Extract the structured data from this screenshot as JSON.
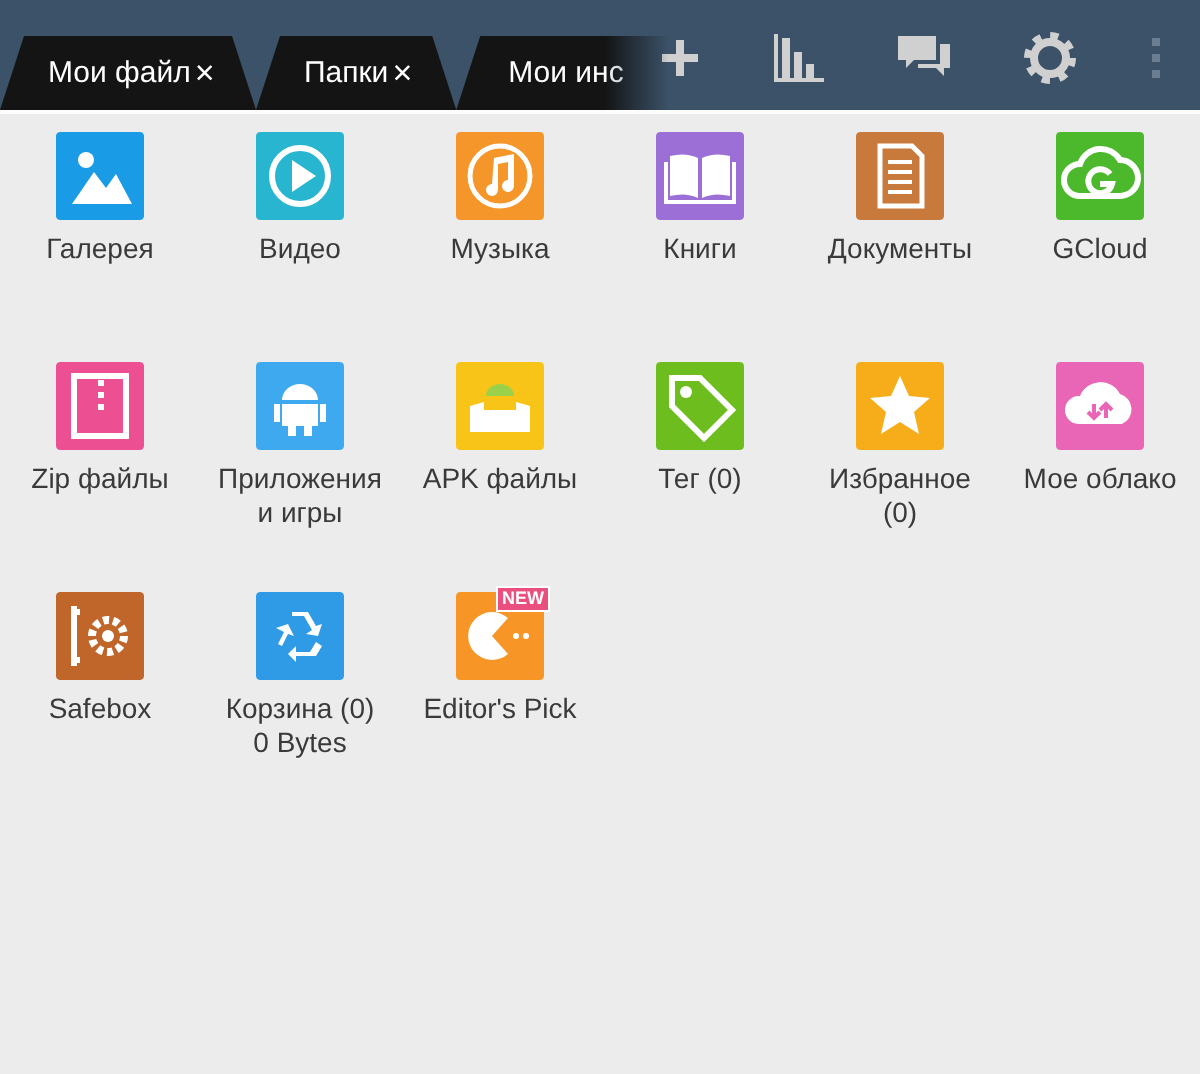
{
  "tabs": [
    {
      "label": "Мои файл",
      "close": "×"
    },
    {
      "label": "Папки",
      "close": "×"
    },
    {
      "label": "Мои инс"
    }
  ],
  "items": [
    {
      "label": "Галерея",
      "kind": "gallery",
      "color": "#1a9be6"
    },
    {
      "label": "Видео",
      "kind": "video",
      "color": "#27b5cf"
    },
    {
      "label": "Музыка",
      "kind": "music",
      "color": "#f5962a"
    },
    {
      "label": "Книги",
      "kind": "books",
      "color": "#9b6fd6"
    },
    {
      "label": "Документы",
      "kind": "documents",
      "color": "#c77a3c"
    },
    {
      "label": "GCloud",
      "kind": "gcloud",
      "color": "#4cb82c"
    },
    {
      "label": "Zip файлы",
      "kind": "zip",
      "color": "#ec4f92"
    },
    {
      "label": "Приложения и игры",
      "kind": "android",
      "color": "#3fa9f0"
    },
    {
      "label": "APK файлы",
      "kind": "apk",
      "color": "#f7c417"
    },
    {
      "label": "Тег (0)",
      "kind": "tag",
      "color": "#6dbd1e"
    },
    {
      "label": "Избранное (0)",
      "kind": "star",
      "color": "#f7ad1a"
    },
    {
      "label": "Мое облако",
      "kind": "cloud",
      "color": "#e866b5"
    },
    {
      "label": "Safebox",
      "kind": "safe",
      "color": "#c0662a"
    },
    {
      "label": "Корзина (0)",
      "detail": "0 Bytes",
      "kind": "recycle",
      "color": "#2f9be6"
    },
    {
      "label": "Editor's Pick",
      "kind": "game",
      "color": "#f79526",
      "badge": "NEW"
    }
  ]
}
